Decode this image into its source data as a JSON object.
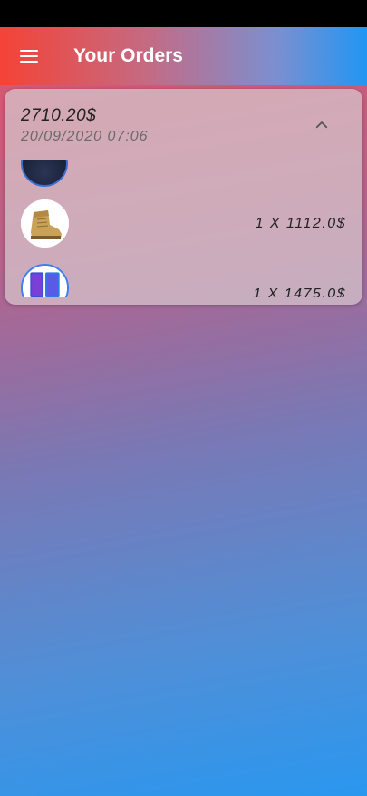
{
  "app_bar": {
    "title": "Your Orders"
  },
  "order": {
    "total": "2710.20$",
    "date": "20/09/2020 07:06",
    "items": [
      {
        "image": "phone-case-thumbnail",
        "quantity_price": ""
      },
      {
        "image": "boot-thumbnail",
        "quantity_price": "1 X  1112.0$"
      },
      {
        "image": "smartphone-thumbnail",
        "quantity_price": "1 X  1475.0$"
      }
    ]
  },
  "colors": {
    "app_bar_left": "#f44336",
    "app_bar_right": "#2196f3"
  }
}
